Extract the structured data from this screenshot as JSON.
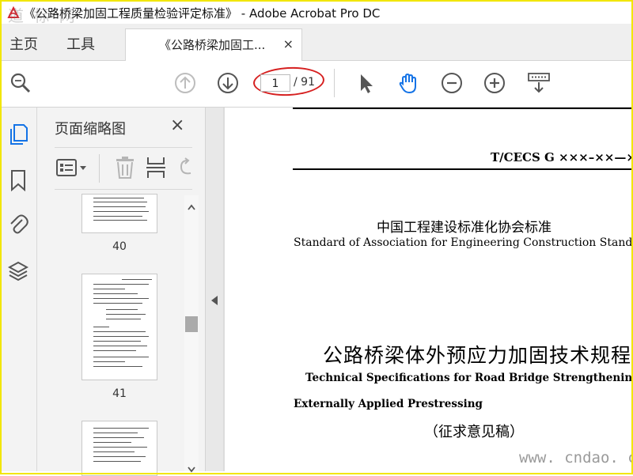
{
  "titlebar": {
    "title": "《公路桥梁加固工程质量检验评定标准》 - Adobe Acrobat Pro DC",
    "watermark": "道 标 网"
  },
  "menu": {
    "home": "主页",
    "tools": "工具",
    "tab_label": "《公路桥梁加固工...",
    "tab_close": "×"
  },
  "toolbar": {
    "current_page": "1",
    "total_pages": "/ 91",
    "icons": [
      "search-zoom-icon",
      "page-up-icon",
      "page-down-icon",
      "select-arrow-icon",
      "hand-tool-icon",
      "zoom-out-icon",
      "zoom-in-icon",
      "fit-page-icon"
    ],
    "highlight_color": "#d62020"
  },
  "leftrail": {
    "icons": [
      "page-thumbnails-icon",
      "bookmark-icon",
      "attachment-icon",
      "layers-icon"
    ],
    "active_color": "#1473e6"
  },
  "thumbnails": {
    "title": "页面缩略图",
    "close": "×",
    "pages": [
      {
        "label": "40"
      },
      {
        "label": "41"
      },
      {
        "label": ""
      }
    ]
  },
  "document": {
    "code": "T/CECS G ×××–××—××",
    "assoc_cn": "中国工程建设标准化协会标准",
    "assoc_en": "Standard of Association for Engineering Construction Standardization",
    "title_cn": "公路桥梁体外预应力加固技术规程",
    "title_en_line1": "Technical Specifications for Road Bridge Strengthening with",
    "title_en_line2": "Externally Applied Prestressing",
    "draft": "（征求意见稿）",
    "watermark": "www. cndao. com"
  }
}
